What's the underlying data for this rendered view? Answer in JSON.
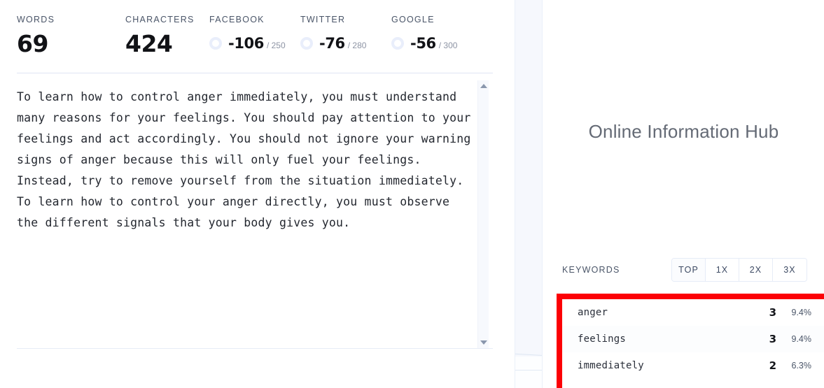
{
  "editor": {
    "stats": [
      {
        "label": "WORDS",
        "value": "69",
        "type": "plain"
      },
      {
        "label": "CHARACTERS",
        "value": "424",
        "type": "plain"
      },
      {
        "label": "FACEBOOK",
        "value": "-106",
        "limit": "/ 250",
        "type": "social",
        "ring_color": "#e9eefb"
      },
      {
        "label": "TWITTER",
        "value": "-76",
        "limit": "/ 280",
        "type": "social",
        "ring_color": "#e9eefb"
      },
      {
        "label": "GOOGLE",
        "value": "-56",
        "limit": "/ 300",
        "type": "social",
        "ring_color": "#e9eefb"
      }
    ],
    "document_text": "To learn how to control anger immediately, you must understand many reasons for your feelings. You should pay attention to your feelings and act accordingly. You should not ignore your warning signs of anger because this will only fuel your feelings. Instead, try to remove yourself from the situation immediately. To learn how to control your anger directly, you must observe the different signals that your body gives you.",
    "scrollbar": {
      "up_icon": "triangle-up-icon",
      "down_icon": "triangle-down-icon"
    }
  },
  "right_panel": {
    "hub_title": "Online Information Hub",
    "keywords_section": {
      "title": "KEYWORDS",
      "filters": [
        {
          "label": "TOP",
          "selected": true
        },
        {
          "label": "1X",
          "selected": false
        },
        {
          "label": "2X",
          "selected": false
        },
        {
          "label": "3X",
          "selected": false
        }
      ],
      "highlight_color": "#fc0006",
      "rows": [
        {
          "word": "anger",
          "count": "3",
          "percent": "9.4%"
        },
        {
          "word": "feelings",
          "count": "3",
          "percent": "9.4%"
        },
        {
          "word": "immediately",
          "count": "2",
          "percent": "6.3%"
        }
      ]
    }
  }
}
